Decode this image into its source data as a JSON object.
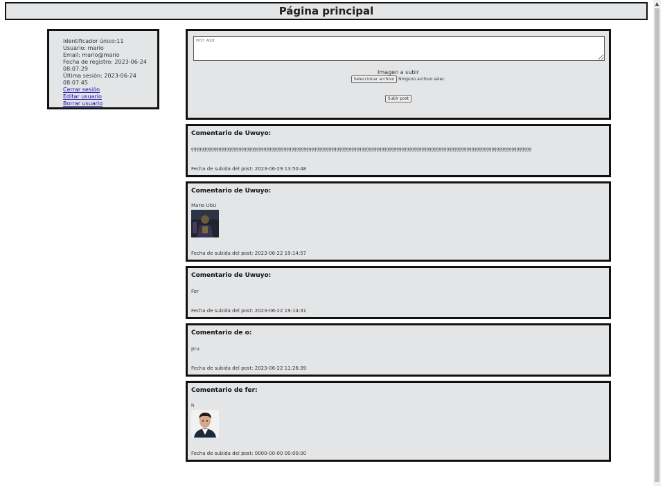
{
  "header": {
    "title": "Página principal"
  },
  "user": {
    "id_line": "Identificador único:11",
    "user_line": "Usuario: mario",
    "email_line": "Email: mario@mario",
    "reg_line": "Fecha de registro: 2023-06-24 08:07:29",
    "last_line": "Última sesión: 2023-06-24 08:07:45",
    "logout": "Cerrar sesión",
    "edit": "Editar usuario",
    "delete": "Borrar usuario"
  },
  "form": {
    "placeholder": "POST AQUI",
    "image_label": "Imagen a subir",
    "file_button": "Seleccionar archivo",
    "file_status": "Ninguno archivo selec.",
    "submit": "Subir post"
  },
  "posts": [
    {
      "title": "Comentario de Uwuyo:",
      "content": "gggggggggggggggggggggggggggggggggggggggggggggggggggggggggggggggggggggggggggggggggggggggggggggggggggggggggggggggggggggggggggggggggggggggg",
      "date": "Fecha de subida del post: 2023-06-29 13:50:48"
    },
    {
      "title": "Comentario de Uwuyo:",
      "content": "Mario UbU",
      "date": "Fecha de subida del post: 2023-06-22 19:14:57"
    },
    {
      "title": "Comentario de Uwuyo:",
      "content": "Fer",
      "date": "Fecha de subida del post: 2023-06-22 19:14:31"
    },
    {
      "title": "Comentario de o:",
      "content": "pru",
      "date": "Fecha de subida del post: 2023-06-22 11:26:39"
    },
    {
      "title": "Comentario de fer:",
      "content": "h",
      "date": "Fecha de subida del post: 0000-00-00 00:00:00"
    }
  ]
}
